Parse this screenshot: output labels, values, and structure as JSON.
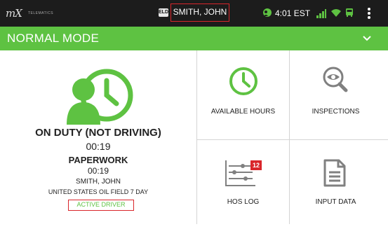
{
  "status_bar": {
    "logo": "mX",
    "logo_sub": "TELEMATICS",
    "eld_badge": "ELD",
    "driver_name": "SMITH, JOHN",
    "time": "4:01 EST",
    "icons": [
      "duty-clock-icon",
      "signal-icon",
      "wifi-icon",
      "bus-icon",
      "menu-icon"
    ]
  },
  "mode_bar": {
    "title": "NORMAL MODE",
    "icon": "chevron-down-icon"
  },
  "status_panel": {
    "duty_status": "ON DUTY (NOT DRIVING)",
    "duty_time": "00:19",
    "activity": "PAPERWORK",
    "activity_time": "00:19",
    "driver": "SMITH, JOHN",
    "ruleset": "UNITED STATES OIL FIELD 7 DAY",
    "active_driver": "ACTIVE DRIVER"
  },
  "tiles": [
    {
      "label": "AVAILABLE HOURS",
      "icon": "clock-icon"
    },
    {
      "label": "INSPECTIONS",
      "icon": "inspect-icon"
    },
    {
      "label": "HOS LOG",
      "icon": "log-icon",
      "badge": "12"
    },
    {
      "label": "INPUT DATA",
      "icon": "document-icon"
    }
  ],
  "colors": {
    "brand_green": "#5ec242",
    "status_bar": "#1c1c1c",
    "highlight_red": "#d9262b"
  }
}
